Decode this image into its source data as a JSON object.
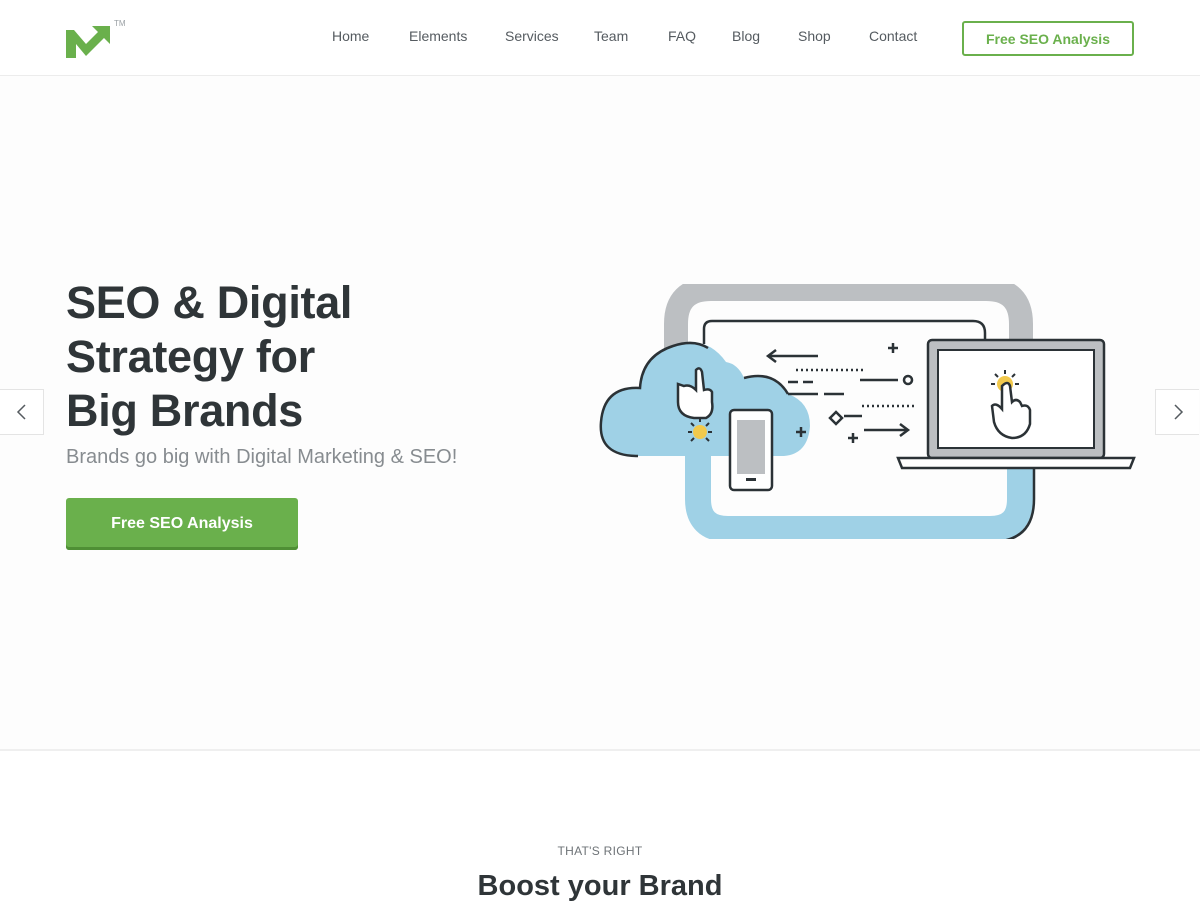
{
  "header": {
    "logo_alt": "M",
    "trademark": "TM",
    "nav": [
      {
        "label": "Home"
      },
      {
        "label": "Elements"
      },
      {
        "label": "Services"
      },
      {
        "label": "Team"
      },
      {
        "label": "FAQ"
      },
      {
        "label": "Blog"
      },
      {
        "label": "Shop"
      },
      {
        "label": "Contact"
      }
    ],
    "cta_label": "Free SEO Analysis"
  },
  "hero": {
    "title_lines": [
      "SEO & Digital",
      "Strategy for",
      "Big Brands"
    ],
    "subtitle": "Brands go big with Digital Marketing & SEO!",
    "cta_label": "Free SEO Analysis",
    "prev_icon": "chevron-left-icon",
    "next_icon": "chevron-right-icon"
  },
  "section": {
    "eyebrow": "THAT'S RIGHT",
    "title": "Boost your Brand"
  },
  "colors": {
    "brand_green": "#6ab04c",
    "heading": "#2f3538",
    "cloud_blue": "#9fd1e6",
    "pipe_gray": "#bcbfc2",
    "accent_yellow": "#f2c94c"
  }
}
